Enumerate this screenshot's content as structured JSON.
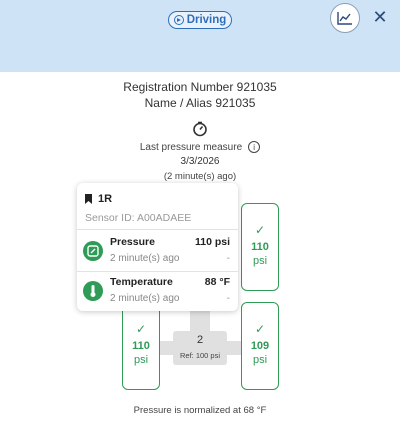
{
  "header": {
    "status_label": "Driving",
    "status_color": "#2f6fba",
    "background": "#cfe3f6",
    "chart_icon": "chart-line-icon",
    "close_icon": "close-icon",
    "close_glyph": "✕"
  },
  "vehicle": {
    "registration": "Registration Number 921035",
    "alias": "Name / Alias 921035"
  },
  "measure": {
    "label": "Last pressure measure",
    "info_glyph": "i",
    "date": "3/3/2026",
    "ago": "(2 minute(s) ago)"
  },
  "tires": [
    {
      "check": "✓",
      "value": "110",
      "unit": "psi"
    },
    {
      "check": "✓",
      "value": "110",
      "unit": "psi"
    },
    {
      "check": "✓",
      "value": "109",
      "unit": "psi"
    }
  ],
  "axle": {
    "number": "2",
    "ref": "Ref: 100 psi"
  },
  "tire_card": {
    "position": "1R",
    "sensor_id": "Sensor ID: A00ADAEE",
    "pressure": {
      "label": "Pressure",
      "value": "110 psi",
      "time": "2 minute(s) ago",
      "dash": "-"
    },
    "temperature": {
      "label": "Temperature",
      "value": "88 °F",
      "time": "2 minute(s) ago",
      "dash": "-"
    },
    "accent_color": "#2e9b57"
  },
  "footer": {
    "note": "Pressure is normalized at 68 °F"
  }
}
